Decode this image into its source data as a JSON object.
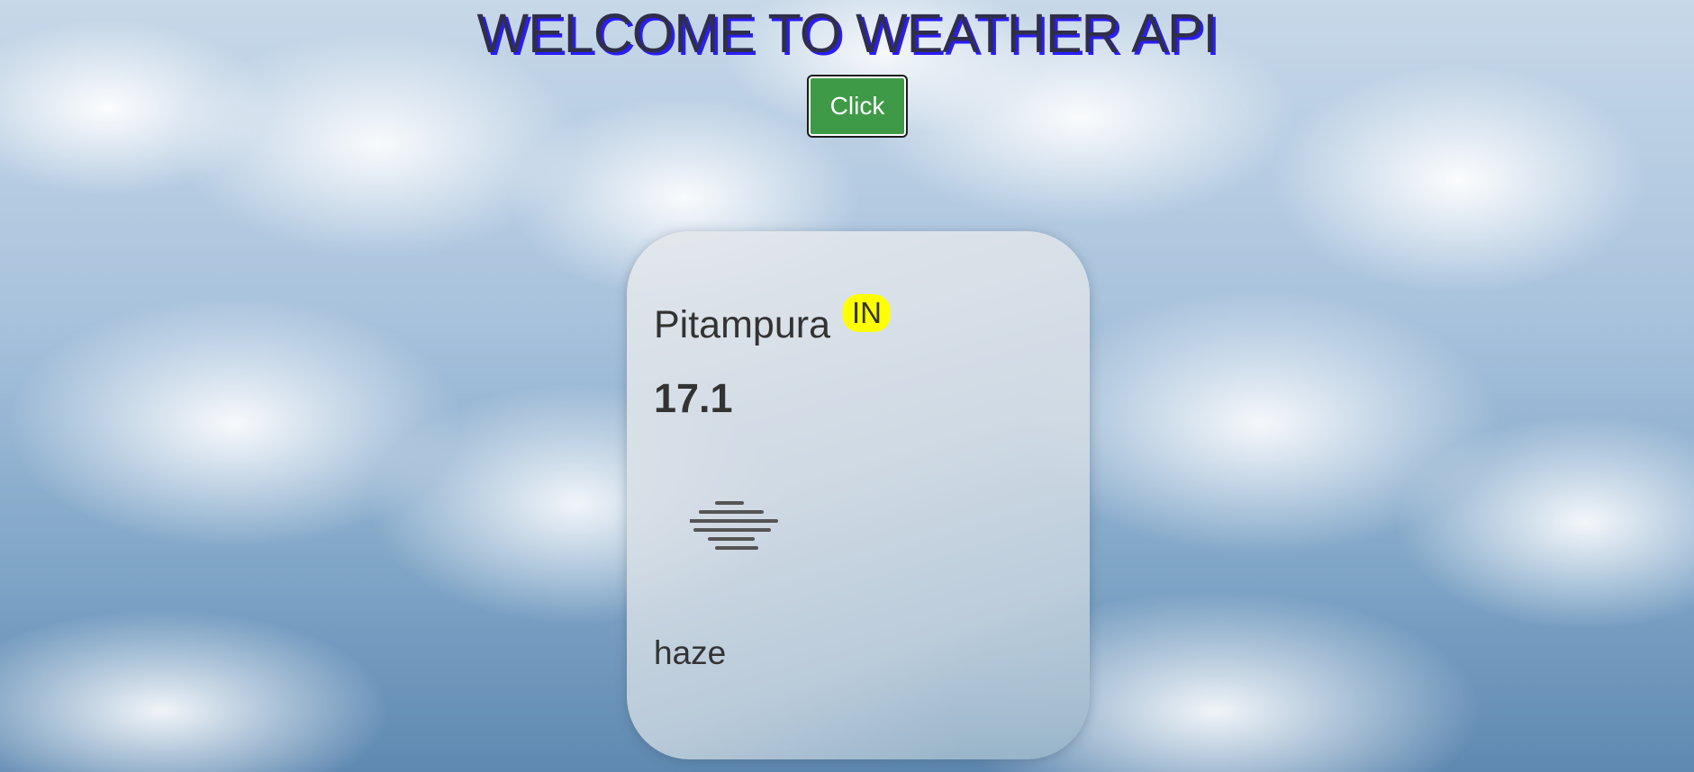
{
  "header": {
    "title": "WELCOME TO WEATHER API"
  },
  "actions": {
    "click_label": "Click"
  },
  "weather": {
    "city": "Pitampura",
    "country": "IN",
    "temperature": "17.1",
    "icon": "haze-icon",
    "condition": "haze"
  },
  "colors": {
    "button_bg": "#3f9a47",
    "badge_bg": "#ffff00",
    "title_shadow": "#2a1cff"
  }
}
